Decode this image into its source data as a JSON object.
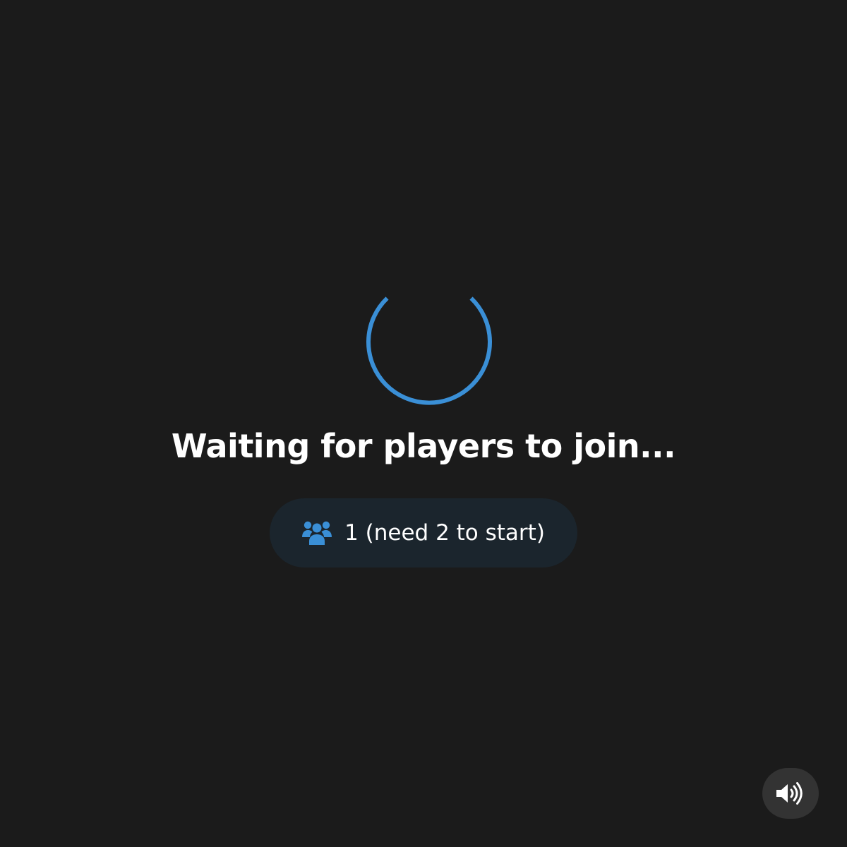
{
  "status": {
    "title": "Waiting for players to join..."
  },
  "players": {
    "icon": "users-icon",
    "text": "1 (need 2 to start)",
    "current": 1,
    "required": 2
  },
  "controls": {
    "sound_icon": "volume-high-icon"
  },
  "colors": {
    "background": "#1b1b1b",
    "accent": "#3a8fd6",
    "pill_background": "#1b252d",
    "button_background": "#333333",
    "text": "#ffffff"
  }
}
